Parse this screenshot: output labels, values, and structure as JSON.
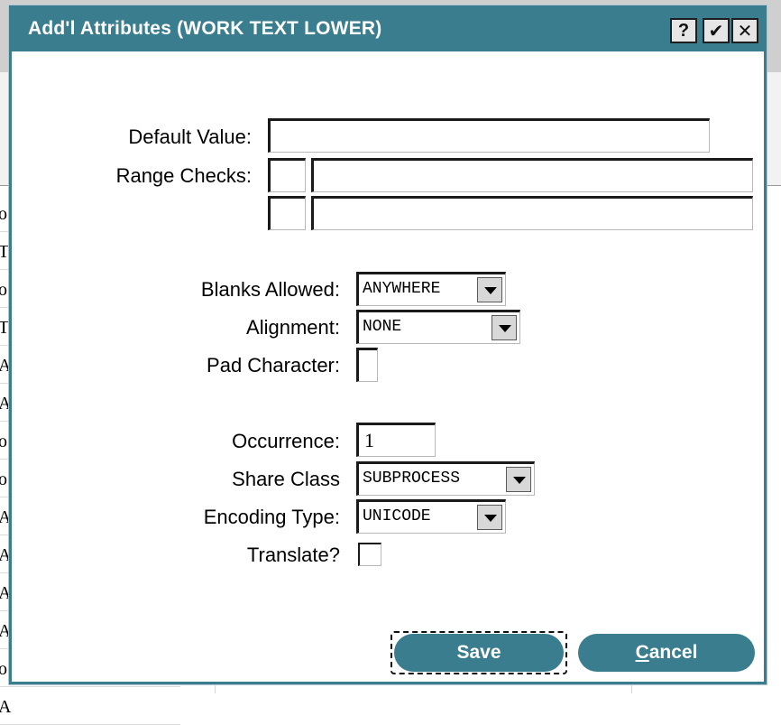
{
  "dialog": {
    "title": "Add'l Attributes  (WORK TEXT LOWER)",
    "help_label": "?",
    "ok_label": "✔",
    "close_label": "✕"
  },
  "fields": {
    "default_value": {
      "label": "Default Value:",
      "value": ""
    },
    "range_checks": {
      "label": "Range Checks:",
      "rows": [
        {
          "op": "",
          "value": ""
        },
        {
          "op": "",
          "value": ""
        }
      ]
    },
    "blanks_allowed": {
      "label": "Blanks Allowed:",
      "value": "ANYWHERE"
    },
    "alignment": {
      "label": "Alignment:",
      "value": "NONE"
    },
    "pad_character": {
      "label": "Pad Character:",
      "value": ""
    },
    "occurrence": {
      "label": "Occurrence:",
      "value": "1"
    },
    "share_class": {
      "label": "Share Class",
      "value": "SUBPROCESS"
    },
    "encoding_type": {
      "label": "Encoding Type:",
      "value": "UNICODE"
    },
    "translate": {
      "label": "Translate?",
      "checked": false
    }
  },
  "buttons": {
    "save": "Save",
    "cancel_first": "C",
    "cancel_rest": "ancel"
  },
  "background": {
    "cells": [
      "o",
      "T",
      "o",
      "T",
      "A",
      "A",
      "o",
      "o",
      "A",
      "A",
      "A",
      "A",
      "o",
      "A"
    ]
  },
  "colors": {
    "accent": "#3a7d8e",
    "window_bg": "#ffffff"
  }
}
